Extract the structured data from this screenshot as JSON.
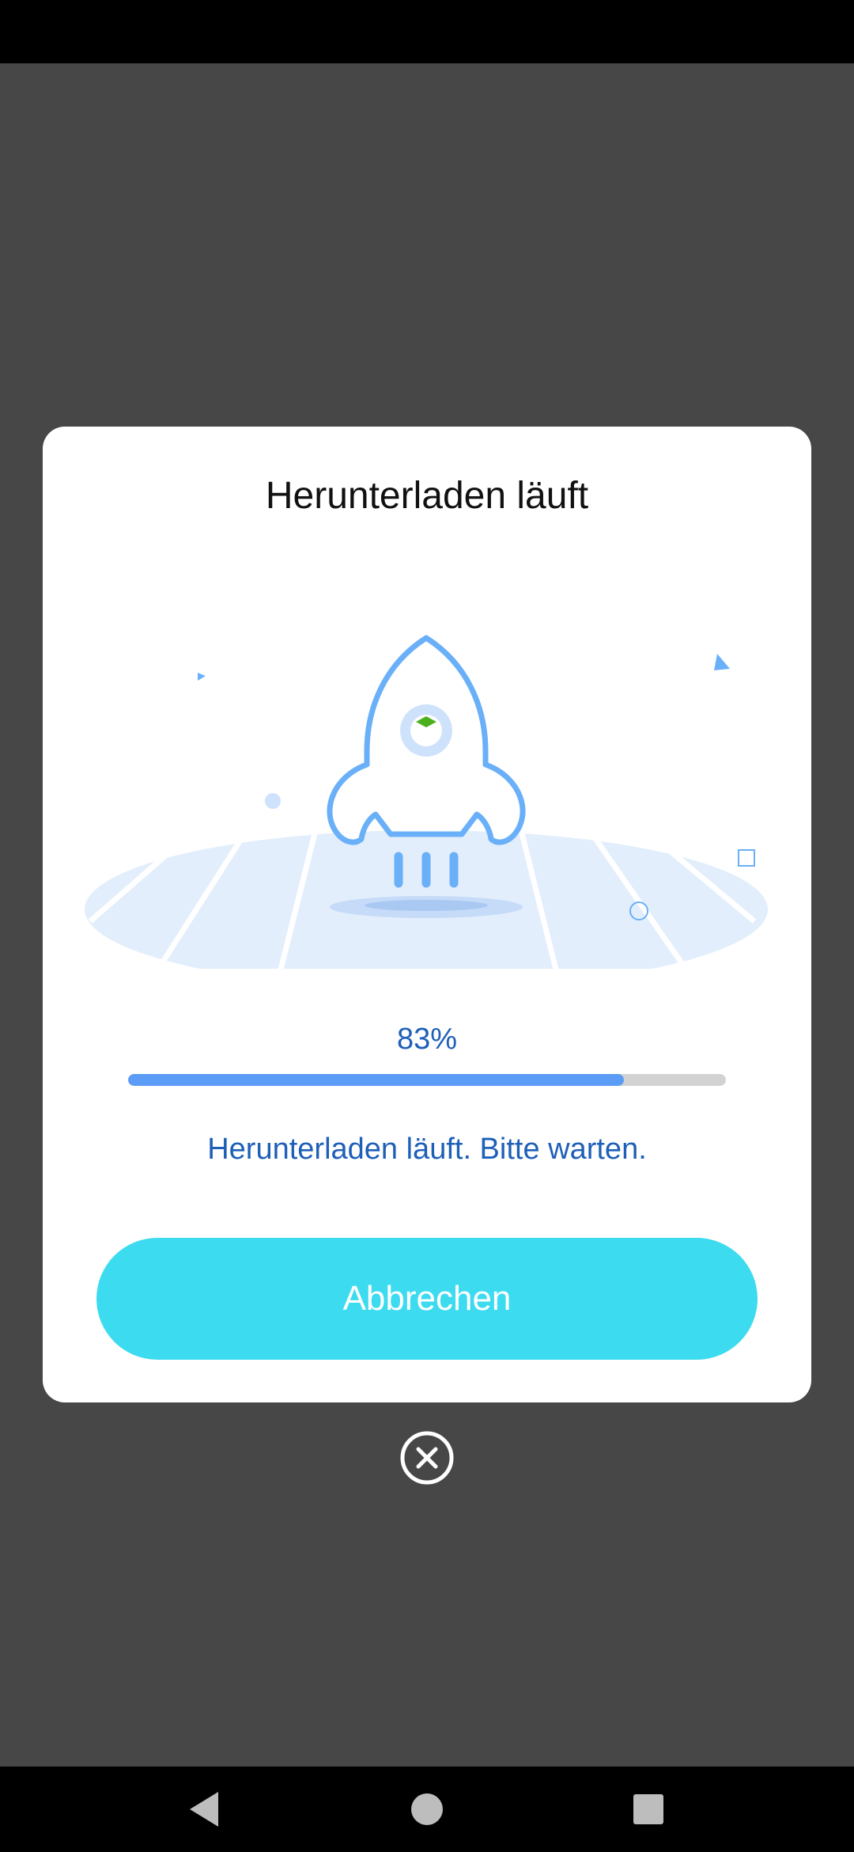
{
  "dialog": {
    "title": "Herunterladen läuft",
    "progress_label": "83%",
    "progress_value": 0.83,
    "message": "Herunterladen läuft. Bitte warten.",
    "cancel_label": "Abbrechen"
  },
  "icons": {
    "illustration": "rocket-launch-illustration",
    "close": "close-circle-icon",
    "nav_back": "back-triangle-icon",
    "nav_home": "home-circle-icon",
    "nav_recents": "recents-square-icon"
  },
  "colors": {
    "overlay": "#474747",
    "accent": "#3cdbef",
    "progress": "#5b9cf6",
    "text_blue": "#1e5fb8"
  }
}
